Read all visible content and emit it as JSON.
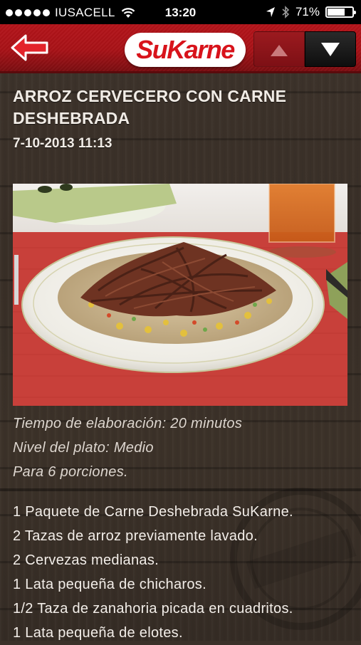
{
  "status_bar": {
    "carrier": "IUSACELL",
    "time": "13:20",
    "battery": "71%",
    "battery_level": 0.71,
    "icons": [
      "signal-dots-icon",
      "wifi-icon",
      "location-arrow-icon",
      "bluetooth-icon",
      "battery-icon"
    ]
  },
  "header": {
    "brand": "SuKarne",
    "back_icon": "back-arrow-icon",
    "nav_up_icon": "triangle-up-icon",
    "nav_down_icon": "triangle-down-icon",
    "colors": {
      "bar": "#a81217",
      "logo_text": "#d8131b",
      "arrow": "#e3242b"
    }
  },
  "recipe": {
    "title": "ARROZ CERVECERO CON CARNE DESHEBRADA",
    "date": "7-10-2013 11:13",
    "photo_alt": "plate-of-rice-with-shredded-beef-image",
    "details": [
      "Tiempo de elaboración: 20 minutos",
      "Nivel del plato: Medio",
      "Para 6 porciones."
    ],
    "ingredients": [
      "1 Paquete de Carne Deshebrada SuKarne.",
      "2 Tazas de arroz previamente lavado.",
      "2 Cervezas medianas.",
      "1 Lata pequeña de chicharos.",
      "1/2 Taza de zanahoria picada en cuadritos.",
      "1 Lata pequeña de elotes."
    ]
  }
}
